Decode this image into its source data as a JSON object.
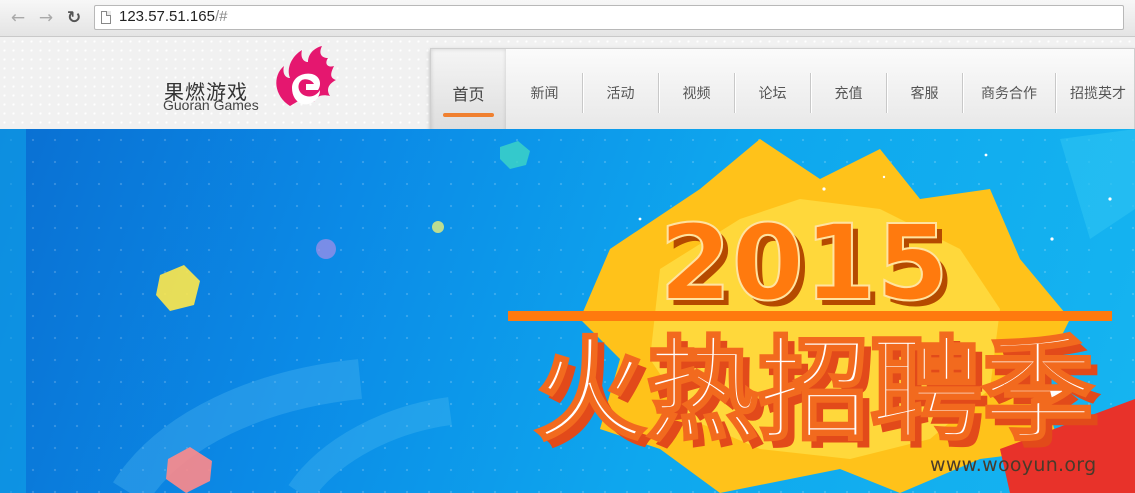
{
  "browser": {
    "back_icon": "arrow-left-icon",
    "forward_icon": "arrow-right-icon",
    "reload_icon": "reload-icon",
    "url_host": "123.57.51.165",
    "url_rest": "/#"
  },
  "header": {
    "logo_cn": "果燃游戏",
    "logo_en": "Guoran Games",
    "brand_color": "#e5176f",
    "menu": [
      {
        "label": "首页",
        "active": true
      },
      {
        "label": "新闻"
      },
      {
        "label": "活动"
      },
      {
        "label": "视频"
      },
      {
        "label": "论坛"
      },
      {
        "label": "充值"
      },
      {
        "label": "客服"
      },
      {
        "label": "商务合作"
      },
      {
        "label": "招揽英才"
      }
    ],
    "accent_color": "#f08030"
  },
  "banner": {
    "year": "2015",
    "headline": "火热招聘季",
    "year_color": "#ff7a0e",
    "headline_color": "#ffffff"
  },
  "watermark": "www.wooyun.org"
}
